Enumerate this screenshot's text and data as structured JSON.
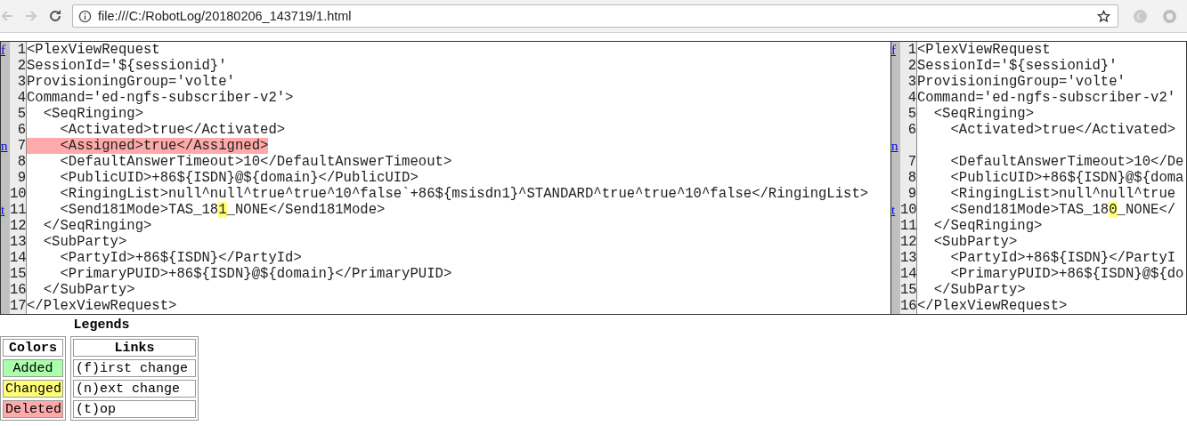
{
  "browser": {
    "url": "file:///C:/RobotLog/20180206_143719/1.html"
  },
  "diff": {
    "panes": [
      {
        "rows": [
          {
            "link": "f",
            "number": "1",
            "segments": [
              {
                "text": "<PlexViewRequest",
                "kind": "plain"
              }
            ]
          },
          {
            "number": "2",
            "segments": [
              {
                "text": "SessionId='${sessionid}'",
                "kind": "plain"
              }
            ]
          },
          {
            "number": "3",
            "segments": [
              {
                "text": "ProvisioningGroup='volte'",
                "kind": "plain"
              }
            ]
          },
          {
            "number": "4",
            "segments": [
              {
                "text": "Command='ed-ngfs-subscriber-v2'>",
                "kind": "plain"
              }
            ]
          },
          {
            "number": "5",
            "segments": [
              {
                "text": "  <SeqRinging>",
                "kind": "plain"
              }
            ]
          },
          {
            "number": "6",
            "segments": [
              {
                "text": "    <Activated>true</Activated>",
                "kind": "plain"
              }
            ]
          },
          {
            "link": "n",
            "number": "7",
            "segments": [
              {
                "text": "    <Assigned>true</Assigned>",
                "kind": "deleted"
              }
            ]
          },
          {
            "number": "8",
            "segments": [
              {
                "text": "    <DefaultAnswerTimeout>10</DefaultAnswerTimeout>",
                "kind": "plain"
              }
            ]
          },
          {
            "number": "9",
            "segments": [
              {
                "text": "    <PublicUID>+86${ISDN}@${domain}</PublicUID>",
                "kind": "plain"
              }
            ]
          },
          {
            "number": "10",
            "segments": [
              {
                "text": "    <RingingList>null^null^true^true^10^false`+86${msisdn1}^STANDARD^true^true^10^false</RingingList>",
                "kind": "plain"
              }
            ]
          },
          {
            "link": "t",
            "number": "11",
            "segments": [
              {
                "text": "    <Send181Mode>TAS_18",
                "kind": "plain"
              },
              {
                "text": "1",
                "kind": "changed"
              },
              {
                "text": "_NONE</Send181Mode>",
                "kind": "plain"
              }
            ]
          },
          {
            "number": "12",
            "segments": [
              {
                "text": "  </SeqRinging>",
                "kind": "plain"
              }
            ]
          },
          {
            "number": "13",
            "segments": [
              {
                "text": "  <SubParty>",
                "kind": "plain"
              }
            ]
          },
          {
            "number": "14",
            "segments": [
              {
                "text": "    <PartyId>+86${ISDN}</PartyId>",
                "kind": "plain"
              }
            ]
          },
          {
            "number": "15",
            "segments": [
              {
                "text": "    <PrimaryPUID>+86${ISDN}@${domain}</PrimaryPUID>",
                "kind": "plain"
              }
            ]
          },
          {
            "number": "16",
            "segments": [
              {
                "text": "  </SubParty>",
                "kind": "plain"
              }
            ]
          },
          {
            "number": "17",
            "segments": [
              {
                "text": "</PlexViewRequest>",
                "kind": "plain"
              }
            ]
          }
        ]
      },
      {
        "rows": [
          {
            "link": "f",
            "number": "1",
            "segments": [
              {
                "text": "<PlexViewRequest",
                "kind": "plain"
              }
            ]
          },
          {
            "number": "2",
            "segments": [
              {
                "text": "SessionId='${sessionid}'",
                "kind": "plain"
              }
            ]
          },
          {
            "number": "3",
            "segments": [
              {
                "text": "ProvisioningGroup='volte'",
                "kind": "plain"
              }
            ]
          },
          {
            "number": "4",
            "segments": [
              {
                "text": "Command='ed-ngfs-subscriber-v2'",
                "kind": "plain"
              }
            ]
          },
          {
            "number": "5",
            "segments": [
              {
                "text": "  <SeqRinging>",
                "kind": "plain"
              }
            ]
          },
          {
            "number": "6",
            "segments": [
              {
                "text": "    <Activated>true</Activated>",
                "kind": "plain"
              }
            ]
          },
          {
            "link": "n"
          },
          {
            "number": "7",
            "segments": [
              {
                "text": "    <DefaultAnswerTimeout>10</De",
                "kind": "plain"
              }
            ]
          },
          {
            "number": "8",
            "segments": [
              {
                "text": "    <PublicUID>+86${ISDN}@${doma",
                "kind": "plain"
              }
            ]
          },
          {
            "number": "9",
            "segments": [
              {
                "text": "    <RingingList>null^null^true",
                "kind": "plain"
              }
            ]
          },
          {
            "link": "t",
            "number": "10",
            "segments": [
              {
                "text": "    <Send181Mode>TAS_18",
                "kind": "plain"
              },
              {
                "text": "0",
                "kind": "changed"
              },
              {
                "text": "_NONE</",
                "kind": "plain"
              }
            ]
          },
          {
            "number": "11",
            "segments": [
              {
                "text": "  </SeqRinging>",
                "kind": "plain"
              }
            ]
          },
          {
            "number": "12",
            "segments": [
              {
                "text": "  <SubParty>",
                "kind": "plain"
              }
            ]
          },
          {
            "number": "13",
            "segments": [
              {
                "text": "    <PartyId>+86${ISDN}</PartyI",
                "kind": "plain"
              }
            ]
          },
          {
            "number": "14",
            "segments": [
              {
                "text": "    <PrimaryPUID>+86${ISDN}@${do",
                "kind": "plain"
              }
            ]
          },
          {
            "number": "15",
            "segments": [
              {
                "text": "  </SubParty>",
                "kind": "plain"
              }
            ]
          },
          {
            "number": "16",
            "segments": [
              {
                "text": "</PlexViewRequest>",
                "kind": "plain"
              }
            ]
          }
        ]
      }
    ]
  },
  "legend": {
    "title": "Legends",
    "colors": {
      "heading": "Colors",
      "items": [
        {
          "label": "Added",
          "color": "#aaffaa"
        },
        {
          "label": "Changed",
          "color": "#ffff77"
        },
        {
          "label": "Deleted",
          "color": "#ffaaaa"
        }
      ]
    },
    "links": {
      "heading": "Links",
      "items": [
        "(f)irst change",
        "(n)ext change",
        "(t)op"
      ]
    }
  }
}
